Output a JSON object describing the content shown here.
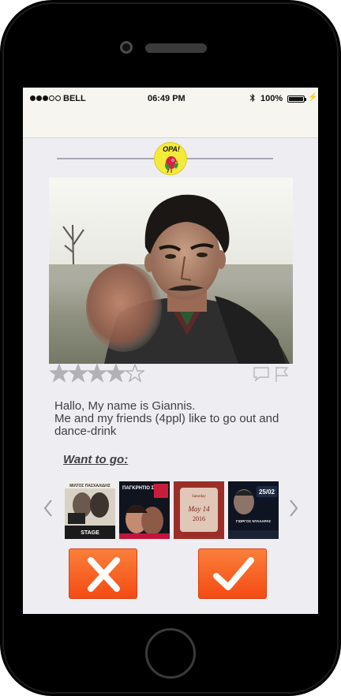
{
  "status_bar": {
    "carrier": "BELL",
    "time": "06:49 PM",
    "battery_percent": "100%",
    "battery_level": 1.0,
    "signal_bars_filled": 3,
    "signal_bars_total": 5,
    "icons": [
      "bluetooth-icon",
      "battery-icon",
      "charging-icon"
    ]
  },
  "logo": {
    "text": "OPA!"
  },
  "profile": {
    "rating": 4,
    "rating_max": 5,
    "bio_line1": "Hallo, My name is Giannis.",
    "bio_line2": "Me and my friends (4ppl) like to go out and dance-drink",
    "action_icons": [
      "chat-bubble-icon",
      "flag-icon"
    ]
  },
  "want_to_go": {
    "heading": "Want to go:",
    "events": [
      {
        "name": "event-poster-stage",
        "top_text": "ΜΙΛΤΟΣ ΠΑΣΧΑΛΙΔΗΣ",
        "bottom_text": "STAGE"
      },
      {
        "name": "event-poster-pagritio",
        "top_text": "ΠΑΓΚΡΗΤΙΟ ΣΤΑΔΙΟ",
        "bottom_text": ""
      },
      {
        "name": "event-poster-may14",
        "top_text": "Saturday",
        "date_text": "May 14 2016"
      },
      {
        "name": "event-poster-25-02",
        "top_text": "25/02",
        "bottom_text": "ΓΙΩΡΓΟΣ ΝΤΑΛΑΡΑΣ"
      }
    ]
  },
  "buttons": {
    "reject": "close-x-icon",
    "accept": "checkmark-icon"
  },
  "colors": {
    "accent": "#f55a1c",
    "screen_bg": "#eeedf2",
    "logo_yellow": "#f4ea3a"
  }
}
